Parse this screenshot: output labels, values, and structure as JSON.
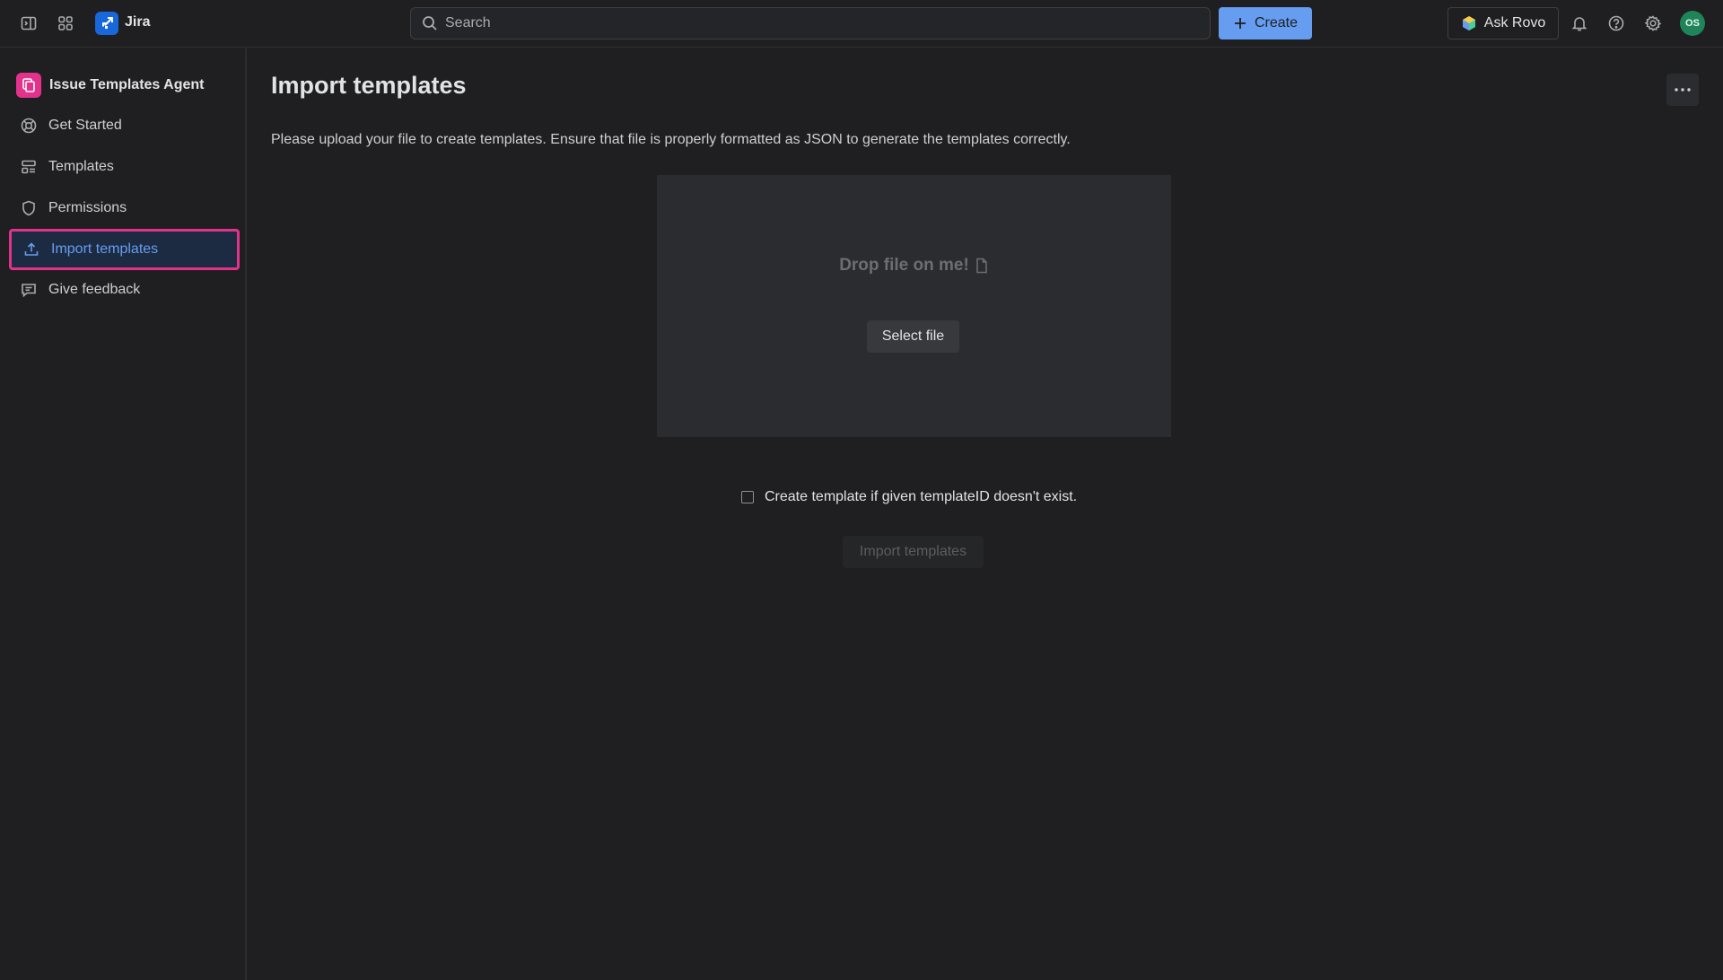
{
  "topbar": {
    "app_name": "Jira",
    "search_placeholder": "Search",
    "create_label": "Create",
    "ask_rovo_label": "Ask Rovo",
    "avatar_initials": "OS"
  },
  "sidebar": {
    "app_title": "Issue Templates Agent",
    "items": [
      {
        "label": "Get Started",
        "icon": "lifebuoy-icon",
        "active": false
      },
      {
        "label": "Templates",
        "icon": "templates-icon",
        "active": false
      },
      {
        "label": "Permissions",
        "icon": "shield-icon",
        "active": false
      },
      {
        "label": "Import templates",
        "icon": "upload-icon",
        "active": true
      },
      {
        "label": "Give feedback",
        "icon": "feedback-icon",
        "active": false
      }
    ]
  },
  "main": {
    "title": "Import templates",
    "description": "Please upload your file to create templates. Ensure that file is properly formatted as JSON to generate the templates correctly.",
    "dropzone": {
      "label": "Drop file on me!",
      "select_button": "Select file"
    },
    "create_if_missing_label": "Create template if given templateID doesn't exist.",
    "create_if_missing_checked": false,
    "import_button": "Import templates",
    "import_button_disabled": true
  },
  "colors": {
    "background": "#1f1f21",
    "primary": "#669df1",
    "highlight_border": "#e2328c",
    "avatar": "#1f845a"
  }
}
